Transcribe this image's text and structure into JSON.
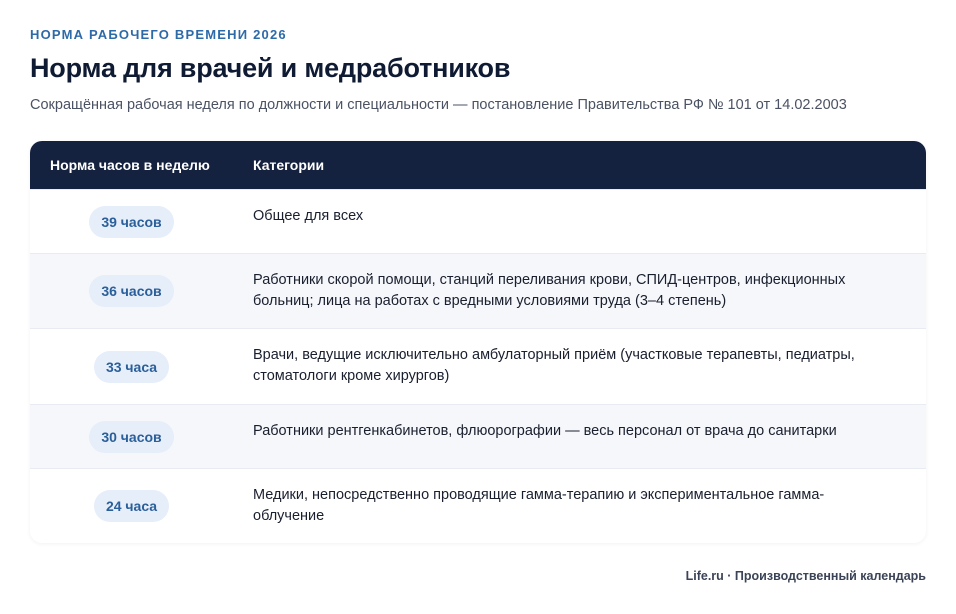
{
  "header": {
    "eyebrow": "НОРМА РАБОЧЕГО ВРЕМЕНИ 2026",
    "title": "Норма для врачей и медработников",
    "subtitle": "Сокращённая рабочая неделя по должности и специальности — постановление Правительства РФ № 101 от 14.02.2003"
  },
  "table": {
    "columns": [
      "Норма часов в неделю",
      "Категории"
    ],
    "rows": [
      {
        "hours": "39 часов",
        "category": "Общее для всех"
      },
      {
        "hours": "36 часов",
        "category": "Работники скорой помощи, станций переливания крови, СПИД-центров, инфекционных больниц; лица на работах с вредными условиями труда (3–4 степень)"
      },
      {
        "hours": "33 часа",
        "category": "Врачи, ведущие исключительно амбулаторный приём (участковые терапевты, педиатры, стоматологи кроме хирургов)"
      },
      {
        "hours": "30 часов",
        "category": "Работники рентгенкабинетов, флюорографии — весь персонал от врача до санитарки"
      },
      {
        "hours": "24 часа",
        "category": "Медики, непосредственно проводящие гамма-терапию и экспериментальное гамма-облучение"
      }
    ]
  },
  "footer": {
    "source": "Life.ru · Производственный календарь"
  }
}
